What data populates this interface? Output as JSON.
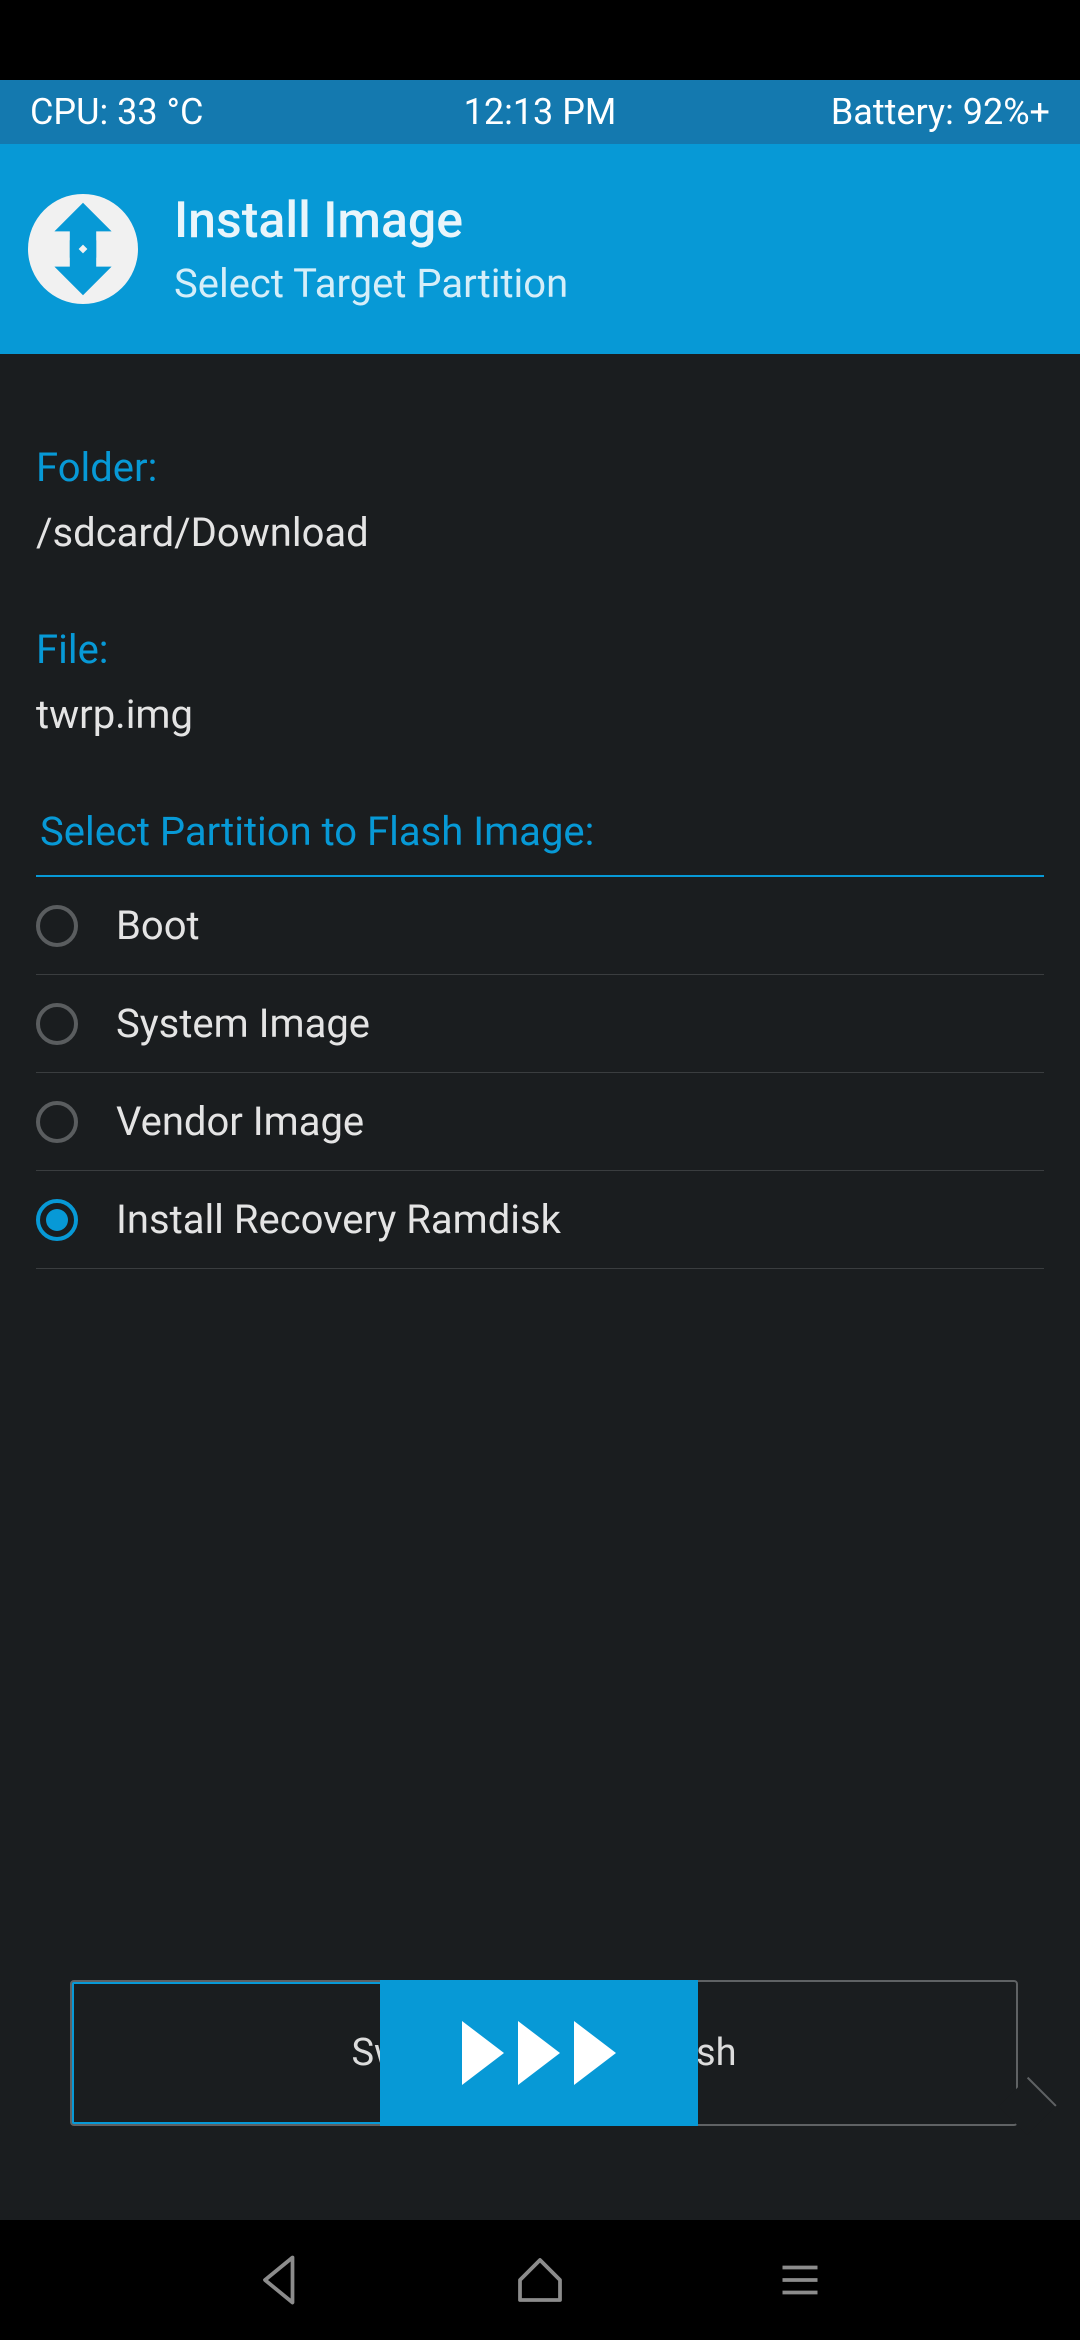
{
  "status": {
    "cpu": "CPU: 33 °C",
    "time": "12:13 PM",
    "battery": "Battery: 92%+"
  },
  "header": {
    "title": "Install Image",
    "subtitle": "Select Target Partition"
  },
  "info": {
    "folder_label": "Folder:",
    "folder_value": "/sdcard/Download",
    "file_label": "File:",
    "file_value": "twrp.img"
  },
  "partition": {
    "title": "Select Partition to Flash Image:",
    "options": [
      {
        "label": "Boot",
        "selected": false
      },
      {
        "label": "System Image",
        "selected": false
      },
      {
        "label": "Vendor Image",
        "selected": false
      },
      {
        "label": "Install Recovery Ramdisk",
        "selected": true
      }
    ]
  },
  "swipe": {
    "label": "Swipe to confirm Flash"
  }
}
